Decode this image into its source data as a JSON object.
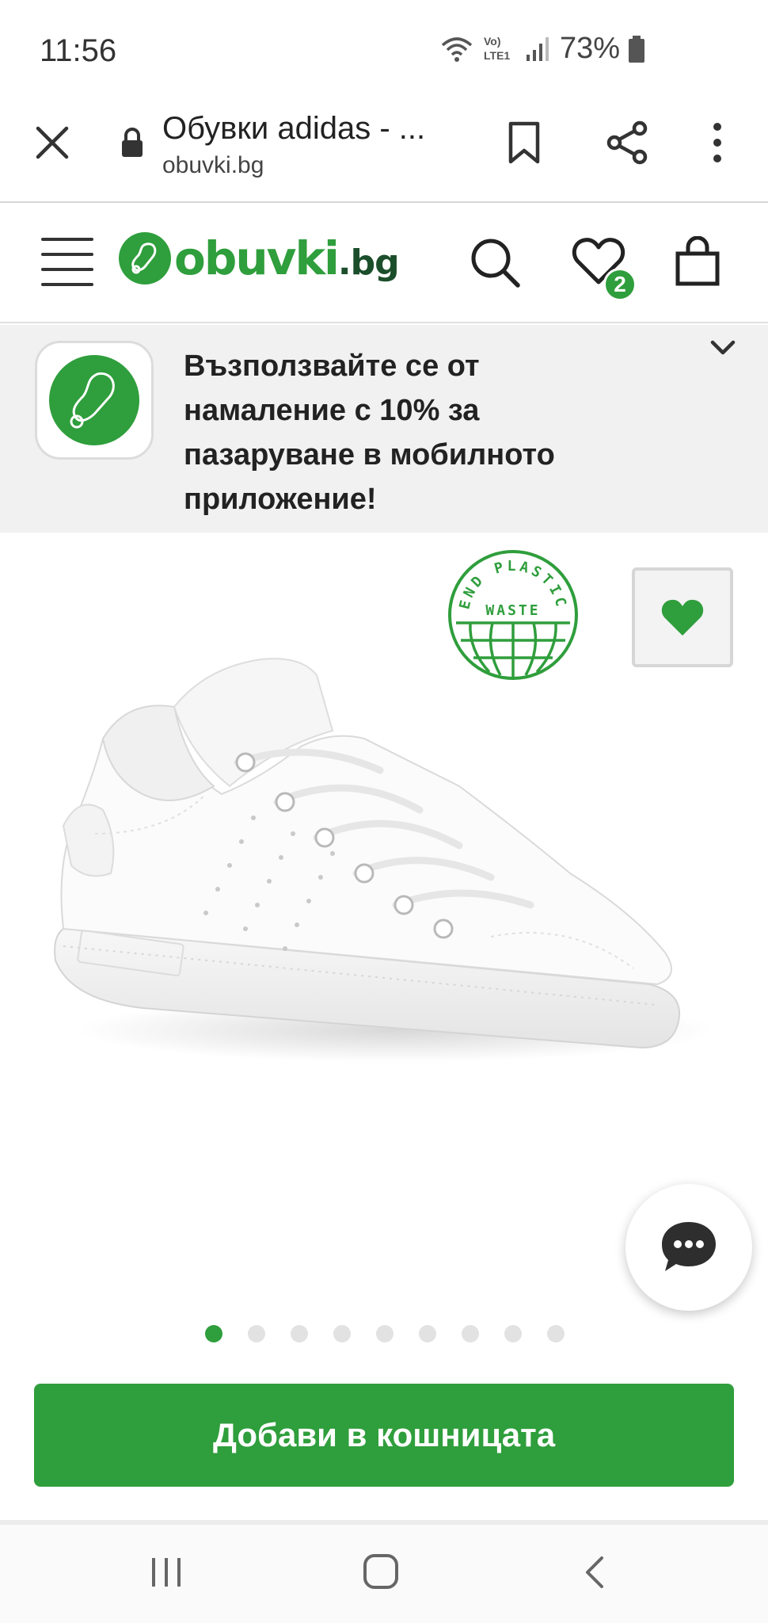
{
  "status_bar": {
    "time": "11:56",
    "battery": "73%",
    "network_label_top": "Vo)",
    "network_label_bottom": "LTE1"
  },
  "browser": {
    "page_title": "Обувки adidas - ...",
    "url": "obuvki.bg"
  },
  "site_header": {
    "logo_text": "obuvki",
    "logo_tld": ".bg",
    "wishlist_count": "2"
  },
  "promo": {
    "text": "Възползвайте се от намаление с 10% за пазаруване в мобилното приложение!"
  },
  "product": {
    "eco_badge": {
      "line1": "END PLASTIC",
      "line2": "WASTE"
    },
    "image_count": 9,
    "active_image_index": 0
  },
  "cta": {
    "label": "Добави в кошницата"
  },
  "colors": {
    "brand_green": "#2f9e3c",
    "brand_dark_green": "#1b4e2b"
  }
}
